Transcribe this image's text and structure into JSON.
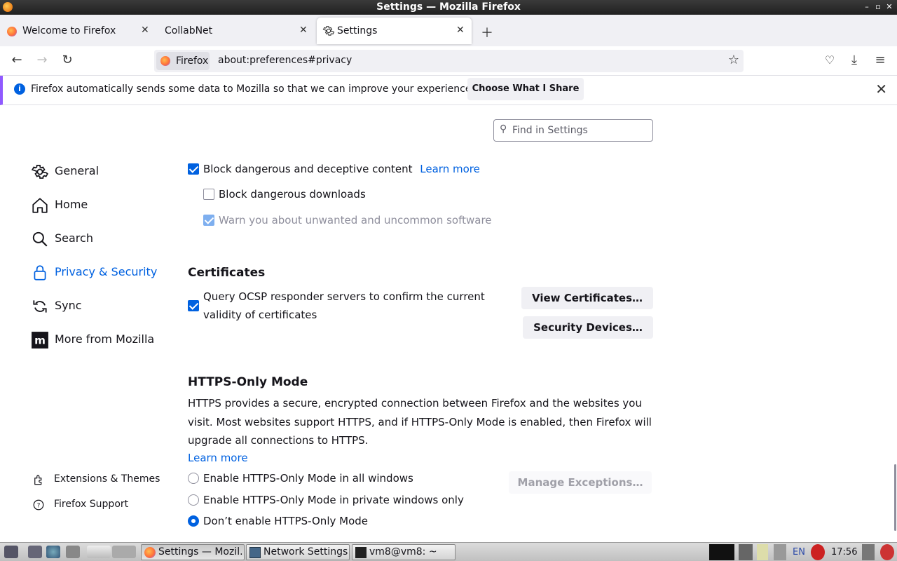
{
  "window": {
    "title": "Settings — Mozilla Firefox"
  },
  "tabs": [
    {
      "title": "Welcome to Firefox"
    },
    {
      "title": "CollabNet"
    },
    {
      "title": "Settings"
    }
  ],
  "navbar": {
    "identity_label": "Firefox",
    "url": "about:preferences#privacy"
  },
  "notification": {
    "message": "Firefox automatically sends some data to Mozilla so that we can improve your experience.",
    "button": "Choose What I Share"
  },
  "search": {
    "placeholder": "Find in Settings"
  },
  "sidebar": {
    "categories": [
      {
        "label": "General",
        "icon": "gear-icon"
      },
      {
        "label": "Home",
        "icon": "home-icon"
      },
      {
        "label": "Search",
        "icon": "search-icon"
      },
      {
        "label": "Privacy & Security",
        "icon": "lock-icon",
        "selected": true
      },
      {
        "label": "Sync",
        "icon": "sync-icon"
      },
      {
        "label": "More from Mozilla",
        "icon": "mozilla-icon"
      }
    ],
    "footer": [
      {
        "label": "Extensions & Themes",
        "icon": "puzzle-icon"
      },
      {
        "label": "Firefox Support",
        "icon": "help-icon"
      }
    ]
  },
  "security": {
    "block_dangerous": {
      "label": "Block dangerous and deceptive content",
      "checked": true,
      "learn_more": "Learn more"
    },
    "block_downloads": {
      "label": "Block dangerous downloads",
      "checked": false
    },
    "warn_unwanted": {
      "label": "Warn you about unwanted and uncommon software",
      "checked": true,
      "disabled": true
    }
  },
  "certificates": {
    "heading": "Certificates",
    "ocsp_line1": "Query OCSP responder servers to confirm the current",
    "ocsp_line2": "validity of certificates",
    "ocsp_checked": true,
    "view_button": "View Certificates…",
    "devices_button": "Security Devices…"
  },
  "https_only": {
    "heading": "HTTPS-Only Mode",
    "description": "HTTPS provides a secure, encrypted connection between Firefox and the websites you visit. Most websites support HTTPS, and if HTTPS-Only Mode is enabled, then Firefox will upgrade all connections to HTTPS.",
    "learn_more": "Learn more",
    "manage_exceptions": "Manage Exceptions…",
    "options": [
      {
        "label": "Enable HTTPS-Only Mode in all windows",
        "checked": false
      },
      {
        "label": "Enable HTTPS-Only Mode in private windows only",
        "checked": false
      },
      {
        "label": "Don’t enable HTTPS-Only Mode",
        "checked": true
      }
    ]
  },
  "taskbar": {
    "tasks": [
      {
        "label": "Settings — Mozil...",
        "active": true
      },
      {
        "label": "Network Settings",
        "active": false
      },
      {
        "label": "vm8@vm8: ~",
        "active": false
      }
    ],
    "lang": "EN",
    "clock": "17:56"
  },
  "colors": {
    "accent": "#0061e0",
    "notification_border": "#9059ff"
  }
}
